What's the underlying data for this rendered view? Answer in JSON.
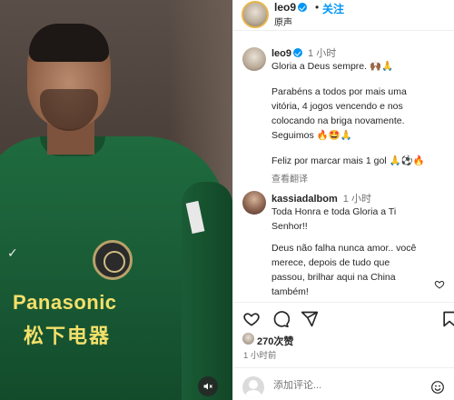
{
  "header": {
    "username": "leo9",
    "dot": "•",
    "follow_label": "关注",
    "subtitle": "原声"
  },
  "comments": [
    {
      "username": "leo9",
      "time": "1 小时",
      "lines": [
        "Gloria a Deus sempre. 🙌🏾🙏",
        "",
        "Parabéns a todos por mais uma",
        "vitória, 4 jogos vencendo e nos",
        "colocando na briga novamente.",
        "Seguimos 🔥🤩🙏",
        "",
        "Feliz por marcar mais 1 gol 🙏⚽🔥"
      ],
      "translate_label": "查看翻译"
    },
    {
      "username": "kassiadalbom",
      "time": "1 小时",
      "lines": [
        "Toda Honra e toda Gloria a Ti",
        "Senhor!!",
        "",
        "Deus não falha nunca amor.. você",
        "merece, depois de tudo que",
        "passou, brilhar aqui na China",
        "também!"
      ]
    }
  ],
  "media": {
    "sponsor_text": "Panasonic",
    "sponsor_cn": "松下电器"
  },
  "stats": {
    "likes": "270次赞",
    "time_ago": "1 小时前"
  },
  "composer": {
    "placeholder": "添加评论..."
  },
  "icons": {
    "like": "heart-icon",
    "comment": "comment-icon",
    "share": "share-icon",
    "save": "bookmark-icon",
    "mute": "speaker-muted-icon",
    "emoji": "emoji-icon"
  },
  "colors": {
    "accent": "#0095f6",
    "jersey": "#1f6b3f",
    "sponsor": "#f4e06a"
  }
}
